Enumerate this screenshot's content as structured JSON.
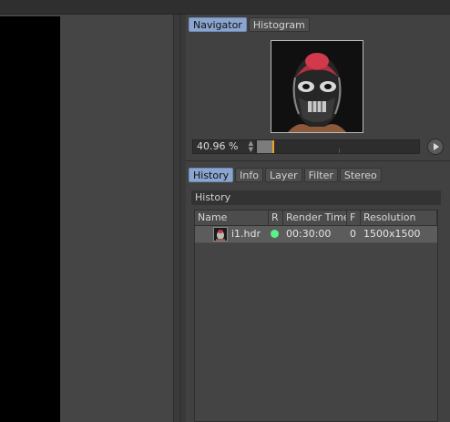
{
  "navigator": {
    "tabs": [
      {
        "label": "Navigator",
        "active": true
      },
      {
        "label": "Histogram",
        "active": false
      }
    ],
    "zoom_value": "40.96 %",
    "zoom_fraction": 0.1
  },
  "history": {
    "tabs": [
      {
        "label": "History",
        "active": true
      },
      {
        "label": "Info",
        "active": false
      },
      {
        "label": "Layer",
        "active": false
      },
      {
        "label": "Filter",
        "active": false
      },
      {
        "label": "Stereo",
        "active": false
      }
    ],
    "section_title": "History",
    "columns": {
      "name": "Name",
      "r": "R",
      "render_time": "Render Time",
      "f": "F",
      "resolution": "Resolution"
    },
    "rows": [
      {
        "name": "i1.hdr",
        "render_time": "00:30:00",
        "f": "0",
        "resolution": "1500x1500",
        "status_color": "#5cf08a"
      }
    ]
  },
  "colors": {
    "accent_tab": "#8aa5cf",
    "zoom_handle": "#f0a02a",
    "status_ok": "#5cf08a"
  }
}
